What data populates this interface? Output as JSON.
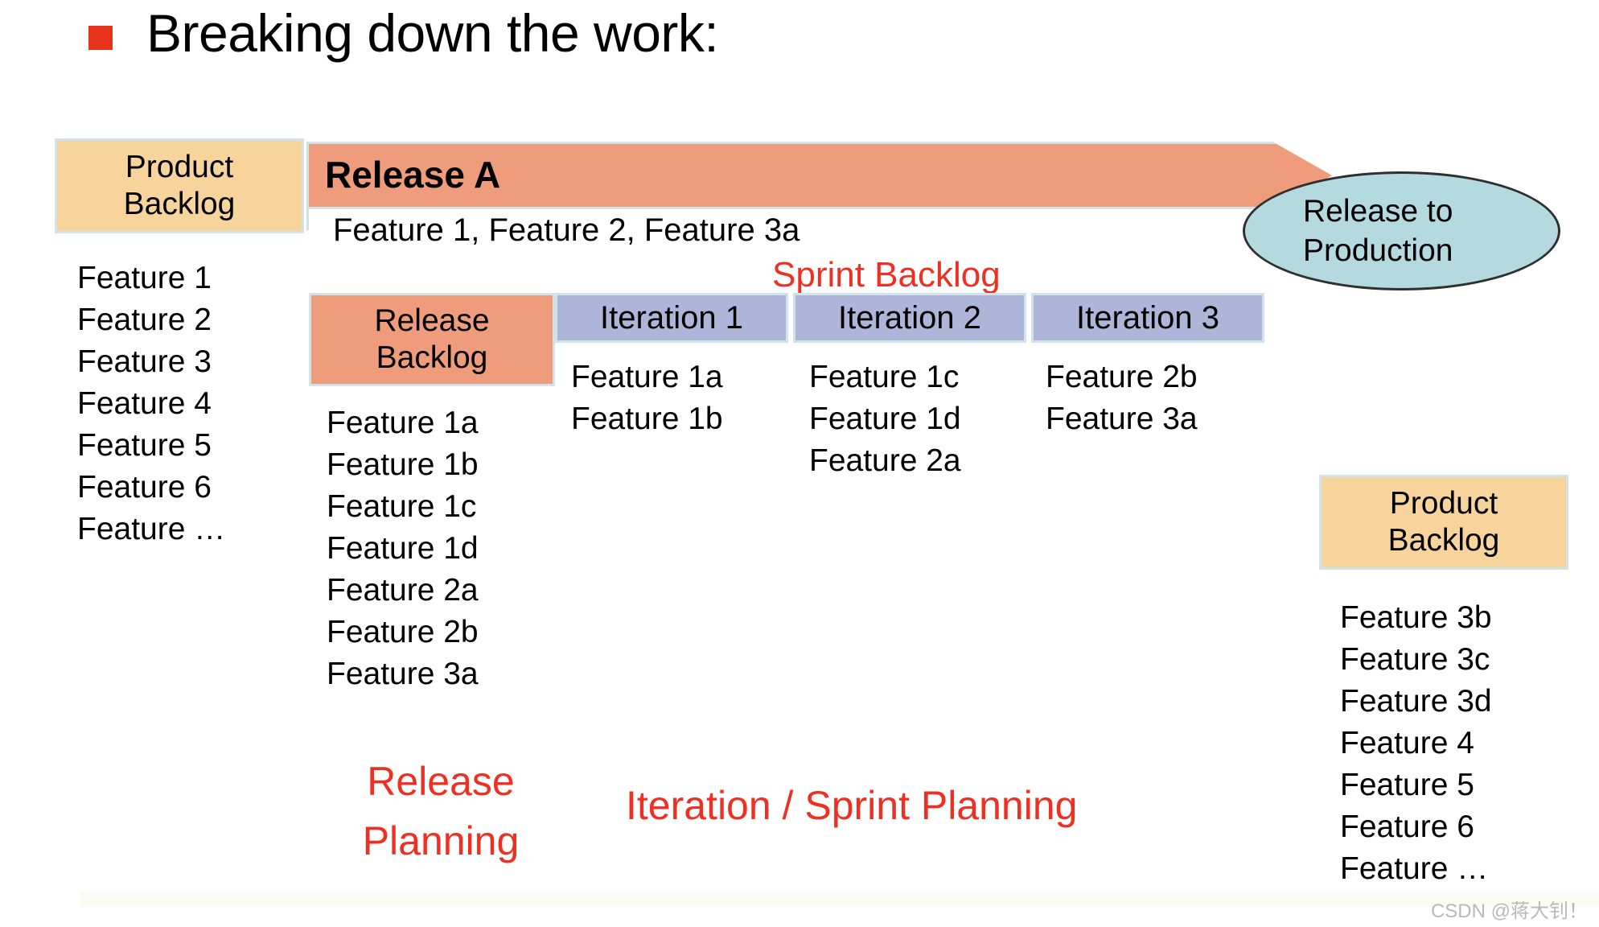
{
  "slide": {
    "title": "Breaking down the work:",
    "bullet_color": "#e8331c",
    "accent_red": "#ee2f22",
    "tan": "#f6d49b",
    "salmon": "#ef9c7d",
    "periwinkle": "#adb5d9",
    "ellipse_fill": "#b4d9de",
    "box_border": "#cfe3e8"
  },
  "product_backlog_left": {
    "title_line1": "Product",
    "title_line2": "Backlog",
    "items": [
      "Feature 1",
      "Feature 2",
      "Feature 3",
      "Feature 4",
      "Feature 5",
      "Feature 6",
      "Feature …"
    ]
  },
  "release_a": {
    "label": "Release A",
    "features_line": "Feature 1, Feature 2, Feature 3a"
  },
  "release_to_production": {
    "line1": "Release to",
    "line2": "Production"
  },
  "sprint_backlog": {
    "label": "Sprint Backlog"
  },
  "release_backlog": {
    "title_line1": "Release",
    "title_line2": "Backlog",
    "items": [
      "Feature 1a",
      "Feature 1b",
      "Feature 1c",
      "Feature 1d",
      "Feature 2a",
      "Feature 2b",
      "Feature 3a"
    ]
  },
  "iterations": [
    {
      "header": "Iteration 1",
      "items": [
        "Feature 1a",
        "Feature 1b"
      ]
    },
    {
      "header": "Iteration 2",
      "items": [
        "Feature 1c",
        "Feature 1d",
        "Feature 2a"
      ]
    },
    {
      "header": "Iteration 3",
      "items": [
        "Feature 2b",
        "Feature 3a"
      ]
    }
  ],
  "product_backlog_right": {
    "title_line1": "Product",
    "title_line2": "Backlog",
    "items": [
      "Feature 3b",
      "Feature 3c",
      "Feature 3d",
      "Feature 4",
      "Feature 5",
      "Feature 6",
      "Feature …"
    ]
  },
  "annotations": {
    "release_planning_line1": "Release",
    "release_planning_line2": "Planning",
    "iteration_planning": "Iteration / Sprint Planning"
  },
  "watermark": "CSDN @蒋大钊！"
}
